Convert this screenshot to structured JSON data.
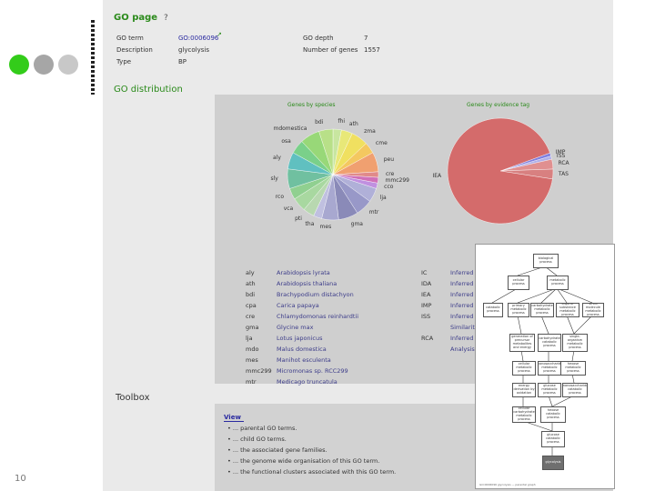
{
  "slide": {
    "number": "10"
  },
  "go_page": {
    "title": "GO page",
    "help_symbol": "?",
    "fields": [
      {
        "label": "GO term",
        "value": "GO:0006096"
      },
      {
        "label": "Description",
        "value": "glycolysis"
      },
      {
        "label": "Type",
        "value": "BP"
      },
      {
        "label": "GO depth",
        "value": "7"
      },
      {
        "label": "Number of genes",
        "value": "1557"
      }
    ],
    "external_link_icon": "external-link-icon"
  },
  "go_distribution": {
    "title": "GO distribution",
    "species_pie_title": "Genes by species",
    "evidence_pie_title": "Genes by evidence tag"
  },
  "colors": {
    "green_dot": "#33cc1a",
    "header_green": "#2a8a1a",
    "link_blue": "#3d3d8a",
    "evidence_red": "#d46b6b",
    "evidence_blue": "#8080e0"
  },
  "chart_data": [
    {
      "type": "pie",
      "title": "Genes by species",
      "categories": [
        "fhi",
        "ath",
        "zma",
        "cme",
        "peu",
        "cre",
        "mmc299",
        "cco",
        "lja",
        "mtr",
        "gma",
        "mes",
        "tha",
        "pti",
        "vca",
        "rco",
        "sly",
        "aly",
        "osa",
        "mdomestica",
        "bdi"
      ],
      "values": [
        3,
        4,
        6,
        4,
        7,
        2,
        2,
        2,
        5,
        6,
        7,
        6,
        3,
        4,
        5,
        4,
        7,
        6,
        5,
        7,
        5
      ]
    },
    {
      "type": "pie",
      "title": "Genes by evidence tag",
      "categories": [
        "IMP",
        "ISS",
        "RCA",
        "TAS",
        "IEA"
      ],
      "values": [
        1,
        1,
        3,
        3,
        92
      ]
    }
  ],
  "species_legend": [
    {
      "code": "aly",
      "name": "Arabidopsis lyrata"
    },
    {
      "code": "ath",
      "name": "Arabidopsis thaliana"
    },
    {
      "code": "bdi",
      "name": "Brachypodium distachyon"
    },
    {
      "code": "cpa",
      "name": "Carica papaya"
    },
    {
      "code": "cre",
      "name": "Chlamydomonas reinhardtii"
    },
    {
      "code": "gma",
      "name": "Glycine max"
    },
    {
      "code": "lja",
      "name": "Lotus japonicus"
    },
    {
      "code": "mdo",
      "name": "Malus domestica"
    },
    {
      "code": "mes",
      "name": "Manihot esculenta"
    },
    {
      "code": "mmc299",
      "name": "Micromonas sp. RCC299"
    },
    {
      "code": "mtr",
      "name": "Medicago truncatula"
    }
  ],
  "evidence_legend": [
    {
      "code": "IC",
      "name": "Inferred"
    },
    {
      "code": "IDA",
      "name": "Inferred"
    },
    {
      "code": "IEA",
      "name": "Inferred"
    },
    {
      "code": "IMP",
      "name": "Inferred"
    },
    {
      "code": "ISS",
      "name": "Inferred"
    },
    {
      "code": "",
      "name": "Similarity"
    },
    {
      "code": "RCA",
      "name": "Inferred"
    },
    {
      "code": "",
      "name": "Analysis"
    }
  ],
  "toolbox": {
    "title": "Toolbox",
    "view_title": "View",
    "items": [
      "... parental GO terms.",
      "... child GO terms.",
      "... the associated gene families.",
      "... the genome wide organisation of this GO term.",
      "... the functional clusters associated with this GO term."
    ]
  },
  "go_graph": {
    "nodes": [
      "biological process",
      "cellular process",
      "metabolic process",
      "catabolic process",
      "primary metabolic process",
      "carbohydrate metabolic process",
      "organic substance metabolic process",
      "small molecule metabolic process",
      "generation of precursor metabolites and energy",
      "carbohydrate catabolic process",
      "single-organism metabolic process",
      "cellular metabolic process",
      "monosaccharide metabolic process",
      "hexose metabolic process",
      "energy derivation by oxidation",
      "glucose metabolic process",
      "monosaccharide catabolic process",
      "cellular carbohydrate metabolic process",
      "hexose catabolic process",
      "glucose catabolic process",
      "glycolysis"
    ],
    "caption": "GO:0006096 glycolysis — parental graph"
  }
}
